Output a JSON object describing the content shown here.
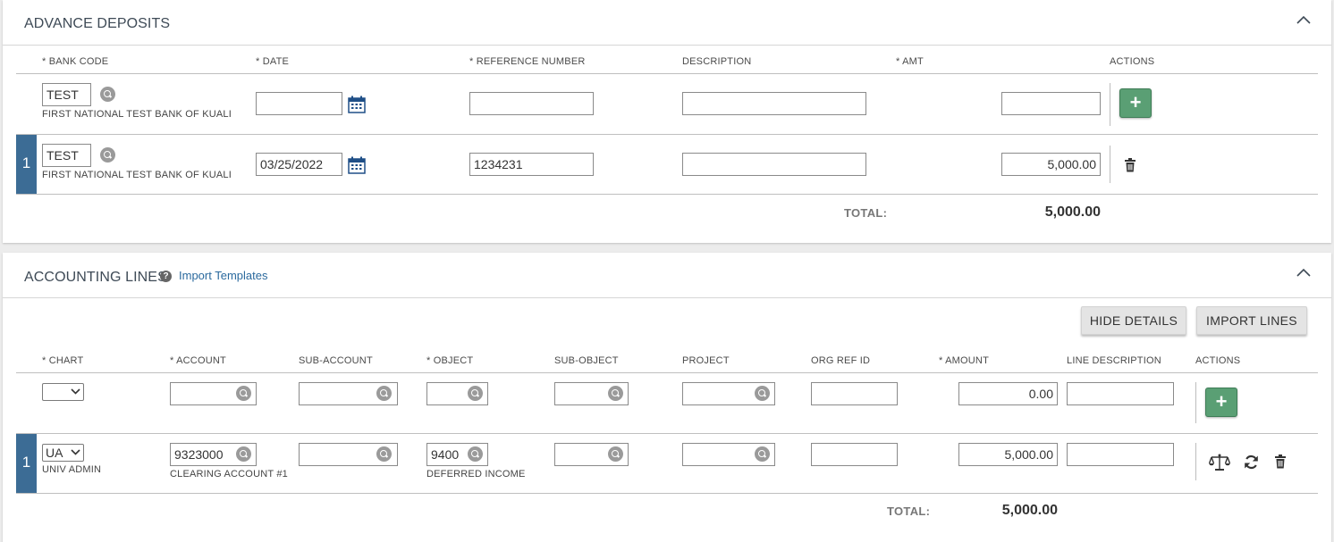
{
  "advance_deposits": {
    "title": "ADVANCE DEPOSITS",
    "headers": {
      "bank_code": "* BANK CODE",
      "date": "* DATE",
      "reference_number": "* REFERENCE NUMBER",
      "description": "DESCRIPTION",
      "amt": "* AMT",
      "actions": "ACTIONS"
    },
    "new_row": {
      "bank_code": "TEST",
      "bank_name": "FIRST NATIONAL TEST BANK OF KUALI",
      "date": "",
      "reference_number": "",
      "description": "",
      "amount": ""
    },
    "rows": [
      {
        "number": "1",
        "bank_code": "TEST",
        "bank_name": "FIRST NATIONAL TEST BANK OF KUALI",
        "date": "03/25/2022",
        "reference_number": "1234231",
        "description": "",
        "amount": "5,000.00"
      }
    ],
    "total_label": "TOTAL:",
    "total_value": "5,000.00"
  },
  "accounting_lines": {
    "title": "ACCOUNTING LINES",
    "import_templates_link": "Import Templates",
    "hide_details_button": "HIDE DETAILS",
    "import_lines_button": "IMPORT LINES",
    "headers": {
      "chart": "* CHART",
      "account": "* ACCOUNT",
      "sub_account": "SUB-ACCOUNT",
      "object": "* OBJECT",
      "sub_object": "SUB-OBJECT",
      "project": "PROJECT",
      "org_ref_id": "ORG REF ID",
      "amount": "* AMOUNT",
      "line_description": "LINE DESCRIPTION",
      "actions": "ACTIONS"
    },
    "new_row": {
      "chart": "",
      "account": "",
      "sub_account": "",
      "object": "",
      "sub_object": "",
      "project": "",
      "org_ref_id": "",
      "amount": "0.00",
      "line_description": ""
    },
    "rows": [
      {
        "number": "1",
        "chart": "UA",
        "chart_name": "UNIV ADMIN",
        "account": "9323000",
        "account_name": "CLEARING ACCOUNT #1",
        "sub_account": "",
        "object": "9400",
        "object_name": "DEFERRED INCOME",
        "sub_object": "",
        "project": "",
        "org_ref_id": "",
        "amount": "5,000.00",
        "line_description": ""
      }
    ],
    "total_label": "TOTAL:",
    "total_value": "5,000.00"
  },
  "icons": {
    "collapse": "chevron-up-icon",
    "lookup": "magnifier-icon",
    "calendar": "calendar-icon",
    "add": "plus-icon",
    "delete": "trash-icon",
    "balance": "balance-scale-icon",
    "refresh": "refresh-icon",
    "help": "question-icon"
  },
  "colors": {
    "row_number_bg": "#3c6c95",
    "add_button": "#5a9f74",
    "link": "#2b6a9e"
  }
}
